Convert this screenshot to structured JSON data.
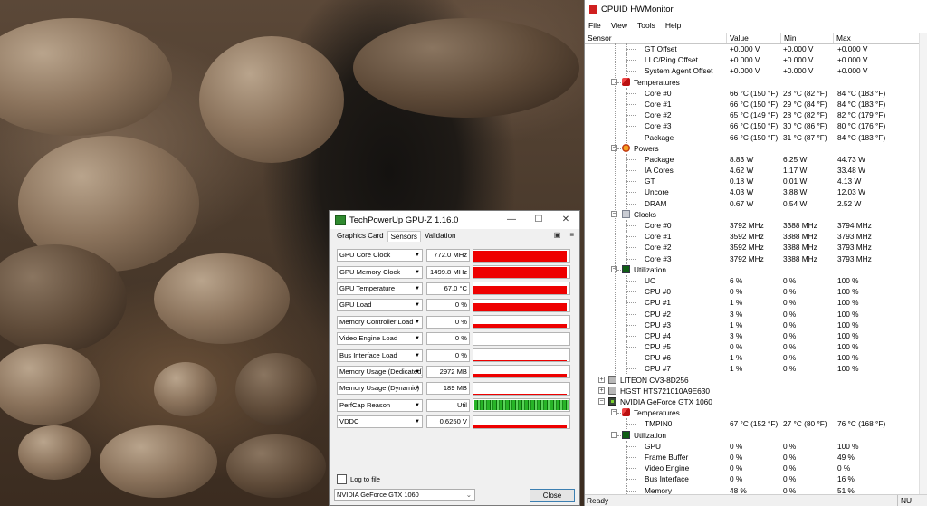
{
  "gpuz": {
    "title": "TechPowerUp GPU-Z 1.16.0",
    "window_controls": {
      "minimize": "—",
      "maximize": "☐",
      "close": "✕"
    },
    "tabs": [
      "Graphics Card",
      "Sensors",
      "Validation"
    ],
    "active_tab": "Sensors",
    "sensors": [
      {
        "name": "GPU Core Clock",
        "value": "772.0 MHz",
        "graph": 0.9
      },
      {
        "name": "GPU Memory Clock",
        "value": "1499.8 MHz",
        "graph": 0.9
      },
      {
        "name": "GPU Temperature",
        "value": "67.0 °C",
        "graph": 0.75
      },
      {
        "name": "GPU Load",
        "value": "0 %",
        "graph": 0.65
      },
      {
        "name": "Memory Controller Load",
        "value": "0 %",
        "graph": 0.3
      },
      {
        "name": "Video Engine Load",
        "value": "0 %",
        "graph": 0
      },
      {
        "name": "Bus Interface Load",
        "value": "0 %",
        "graph": 0.1
      },
      {
        "name": "Memory Usage (Dedicated)",
        "value": "2972 MB",
        "graph": 0.35
      },
      {
        "name": "Memory Usage (Dynamic)",
        "value": "189 MB",
        "graph": 0.05
      },
      {
        "name": "PerfCap Reason",
        "value": "Util",
        "graph": "perfcap"
      },
      {
        "name": "VDDC",
        "value": "0.6250 V",
        "graph": 0.3
      }
    ],
    "log_to_file_label": "Log to file",
    "gpu_selected": "NVIDIA GeForce GTX 1060",
    "close_label": "Close",
    "graph_color": "#ee0000"
  },
  "hwmonitor": {
    "title": "CPUID HWMonitor",
    "menu": [
      "File",
      "View",
      "Tools",
      "Help"
    ],
    "columns": [
      "Sensor",
      "Value",
      "Min",
      "Max"
    ],
    "rows": [
      {
        "label": "GT Offset",
        "level": 3,
        "value": "+0.000 V",
        "min": "+0.000 V",
        "max": "+0.000 V"
      },
      {
        "label": "LLC/Ring Offset",
        "level": 3,
        "value": "+0.000 V",
        "min": "+0.000 V",
        "max": "+0.000 V"
      },
      {
        "label": "System Agent Offset",
        "level": 3,
        "value": "+0.000 V",
        "min": "+0.000 V",
        "max": "+0.000 V"
      },
      {
        "label": "Temperatures",
        "level": 2,
        "icon": "thermometer-icon",
        "kind": "temp"
      },
      {
        "label": "Core #0",
        "level": 3,
        "value": "66 °C  (150 °F)",
        "min": "28 °C  (82 °F)",
        "max": "84 °C  (183 °F)"
      },
      {
        "label": "Core #1",
        "level": 3,
        "value": "66 °C  (150 °F)",
        "min": "29 °C  (84 °F)",
        "max": "84 °C  (183 °F)"
      },
      {
        "label": "Core #2",
        "level": 3,
        "value": "65 °C  (149 °F)",
        "min": "28 °C  (82 °F)",
        "max": "82 °C  (179 °F)"
      },
      {
        "label": "Core #3",
        "level": 3,
        "value": "66 °C  (150 °F)",
        "min": "30 °C  (86 °F)",
        "max": "80 °C  (176 °F)"
      },
      {
        "label": "Package",
        "level": 3,
        "value": "66 °C  (150 °F)",
        "min": "31 °C  (87 °F)",
        "max": "84 °C  (183 °F)"
      },
      {
        "label": "Powers",
        "level": 2,
        "icon": "power-icon",
        "kind": "pow"
      },
      {
        "label": "Package",
        "level": 3,
        "value": "8.83 W",
        "min": "6.25 W",
        "max": "44.73 W"
      },
      {
        "label": "IA Cores",
        "level": 3,
        "value": "4.62 W",
        "min": "1.17 W",
        "max": "33.48 W"
      },
      {
        "label": "GT",
        "level": 3,
        "value": "0.18 W",
        "min": "0.01 W",
        "max": "4.13 W"
      },
      {
        "label": "Uncore",
        "level": 3,
        "value": "4.03 W",
        "min": "3.88 W",
        "max": "12.03 W"
      },
      {
        "label": "DRAM",
        "level": 3,
        "value": "0.67 W",
        "min": "0.54 W",
        "max": "2.52 W"
      },
      {
        "label": "Clocks",
        "level": 2,
        "icon": "clock-icon",
        "kind": "clk"
      },
      {
        "label": "Core #0",
        "level": 3,
        "value": "3792 MHz",
        "min": "3388 MHz",
        "max": "3794 MHz"
      },
      {
        "label": "Core #1",
        "level": 3,
        "value": "3592 MHz",
        "min": "3388 MHz",
        "max": "3793 MHz"
      },
      {
        "label": "Core #2",
        "level": 3,
        "value": "3592 MHz",
        "min": "3388 MHz",
        "max": "3793 MHz"
      },
      {
        "label": "Core #3",
        "level": 3,
        "value": "3792 MHz",
        "min": "3388 MHz",
        "max": "3793 MHz"
      },
      {
        "label": "Utilization",
        "level": 2,
        "icon": "utilization-icon",
        "kind": "util"
      },
      {
        "label": "UC",
        "level": 3,
        "value": "6 %",
        "min": "0 %",
        "max": "100 %"
      },
      {
        "label": "CPU #0",
        "level": 3,
        "value": "0 %",
        "min": "0 %",
        "max": "100 %"
      },
      {
        "label": "CPU #1",
        "level": 3,
        "value": "1 %",
        "min": "0 %",
        "max": "100 %"
      },
      {
        "label": "CPU #2",
        "level": 3,
        "value": "3 %",
        "min": "0 %",
        "max": "100 %"
      },
      {
        "label": "CPU #3",
        "level": 3,
        "value": "1 %",
        "min": "0 %",
        "max": "100 %"
      },
      {
        "label": "CPU #4",
        "level": 3,
        "value": "3 %",
        "min": "0 %",
        "max": "100 %"
      },
      {
        "label": "CPU #5",
        "level": 3,
        "value": "0 %",
        "min": "0 %",
        "max": "100 %"
      },
      {
        "label": "CPU #6",
        "level": 3,
        "value": "1 %",
        "min": "0 %",
        "max": "100 %"
      },
      {
        "label": "CPU #7",
        "level": 3,
        "value": "1 %",
        "min": "0 %",
        "max": "100 %"
      },
      {
        "label": "LITEON CV3-8D256",
        "level": 1,
        "icon": "drive-icon",
        "kind": "hdd",
        "toggle": "+"
      },
      {
        "label": "HGST HTS721010A9E630",
        "level": 1,
        "icon": "drive-icon",
        "kind": "hdd",
        "toggle": "+"
      },
      {
        "label": "NVIDIA GeForce GTX 1060",
        "level": 1,
        "icon": "gpu-icon",
        "kind": "gpu",
        "toggle": "−"
      },
      {
        "label": "Temperatures",
        "level": 2,
        "icon": "thermometer-icon",
        "kind": "temp"
      },
      {
        "label": "TMPIN0",
        "level": 3,
        "value": "67 °C  (152 °F)",
        "min": "27 °C  (80 °F)",
        "max": "76 °C  (168 °F)"
      },
      {
        "label": "Utilization",
        "level": 2,
        "icon": "utilization-icon",
        "kind": "util"
      },
      {
        "label": "GPU",
        "level": 3,
        "value": "0 %",
        "min": "0 %",
        "max": "100 %"
      },
      {
        "label": "Frame Buffer",
        "level": 3,
        "value": "0 %",
        "min": "0 %",
        "max": "49 %"
      },
      {
        "label": "Video Engine",
        "level": 3,
        "value": "0 %",
        "min": "0 %",
        "max": "0 %"
      },
      {
        "label": "Bus Interface",
        "level": 3,
        "value": "0 %",
        "min": "0 %",
        "max": "16 %"
      },
      {
        "label": "Memory",
        "level": 3,
        "value": "48 %",
        "min": "0 %",
        "max": "51 %"
      }
    ],
    "status": "Ready",
    "num_indicator": "NU"
  }
}
